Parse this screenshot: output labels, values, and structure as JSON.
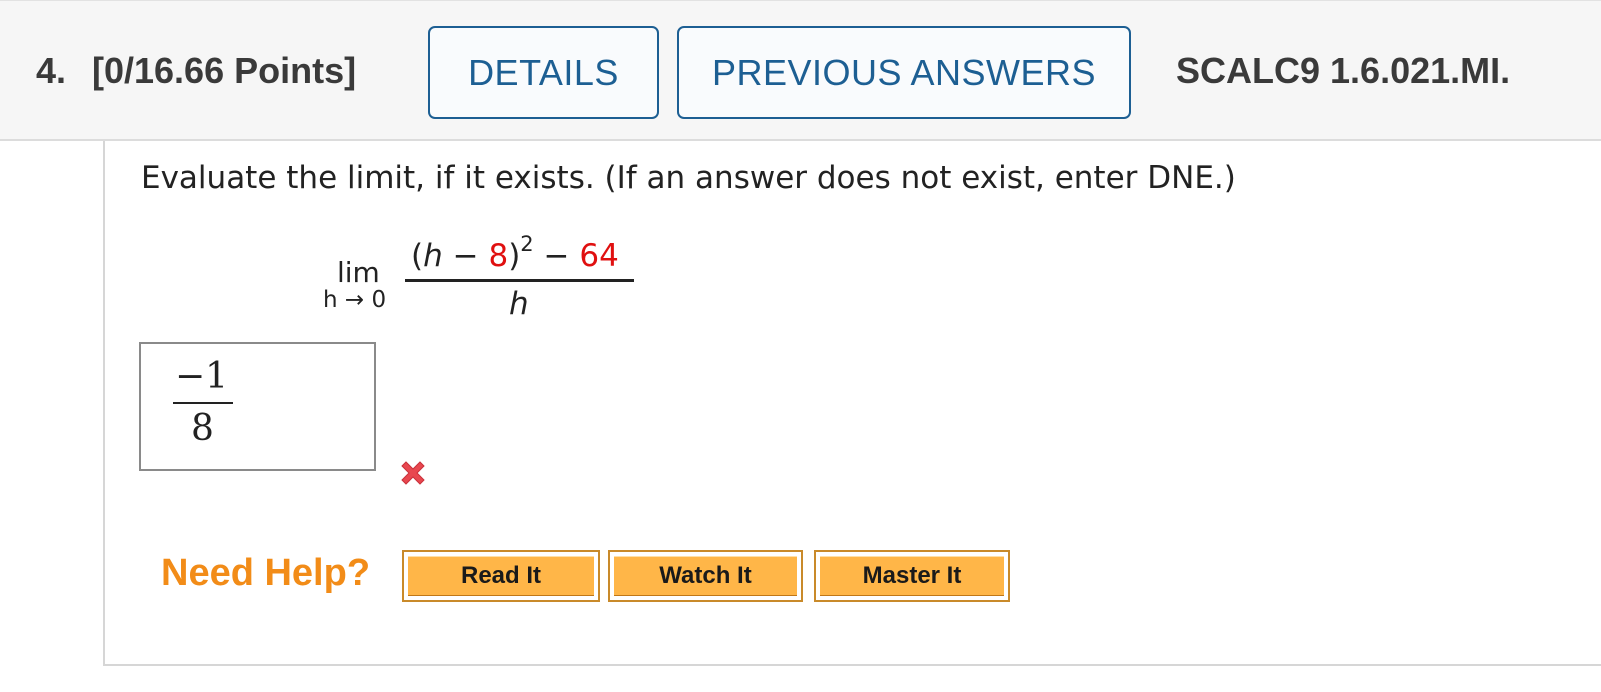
{
  "header": {
    "question_number": "4.",
    "points": "[0/16.66 Points]",
    "details_label": "DETAILS",
    "previous_answers_label": "PREVIOUS ANSWERS",
    "source_code": "SCALC9 1.6.021.MI."
  },
  "question": {
    "prompt": "Evaluate the limit, if it exists. (If an answer does not exist, enter DNE.)",
    "limit": {
      "operator": "lim",
      "subscript": "h → 0",
      "numerator": {
        "open": "(",
        "var": "h",
        "minus1": " − ",
        "const1": "8",
        "close": ")",
        "exponent": "2",
        "minus2": " − ",
        "const2": "64"
      },
      "denominator": "h"
    },
    "constant_color": "#e01010"
  },
  "answer": {
    "numerator": "−1",
    "denominator": "8",
    "status_icon": "x-mark-icon",
    "status": "incorrect",
    "status_color": "#e8474f"
  },
  "help": {
    "label": "Need Help?",
    "buttons": [
      "Read It",
      "Watch It",
      "Master It"
    ],
    "label_color": "#f28c18",
    "button_color": "#ffb648"
  }
}
